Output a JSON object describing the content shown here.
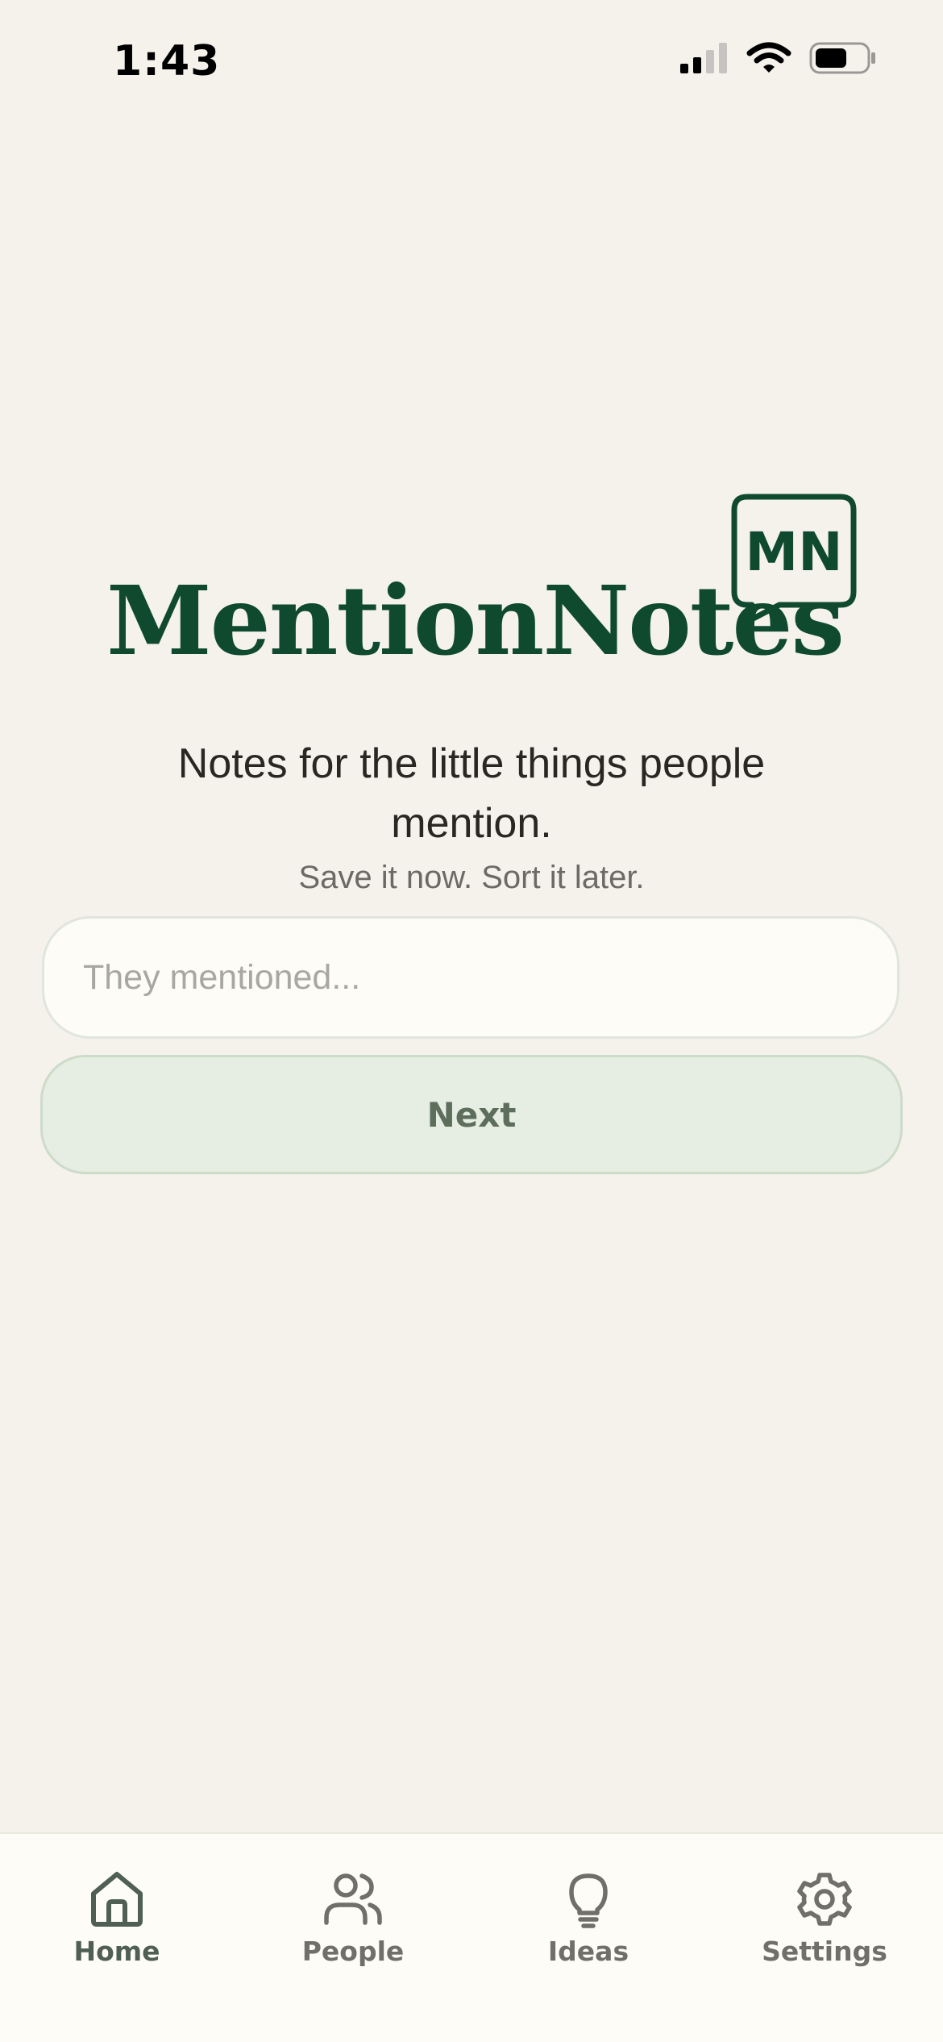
{
  "status_bar": {
    "time": "1:43"
  },
  "logo": {
    "wordmark": "MentionNotes",
    "badge_text": "MN",
    "color": "#0f4a2e"
  },
  "hero": {
    "tagline": "Notes for the little things people mention.",
    "subtitle": "Save it now. Sort it later."
  },
  "mention_input": {
    "value": "",
    "placeholder": "They mentioned..."
  },
  "actions": {
    "next_label": "Next"
  },
  "tab_bar": {
    "active": "Home",
    "items": [
      {
        "label": "Home",
        "icon": "home-icon"
      },
      {
        "label": "People",
        "icon": "people-icon"
      },
      {
        "label": "Ideas",
        "icon": "lightbulb-icon"
      },
      {
        "label": "Settings",
        "icon": "gear-icon"
      }
    ]
  },
  "colors": {
    "background": "#f5f2ec",
    "accent": "#0f4a2e",
    "button_fill": "#e6ede2",
    "tab_active": "#4f6052"
  }
}
